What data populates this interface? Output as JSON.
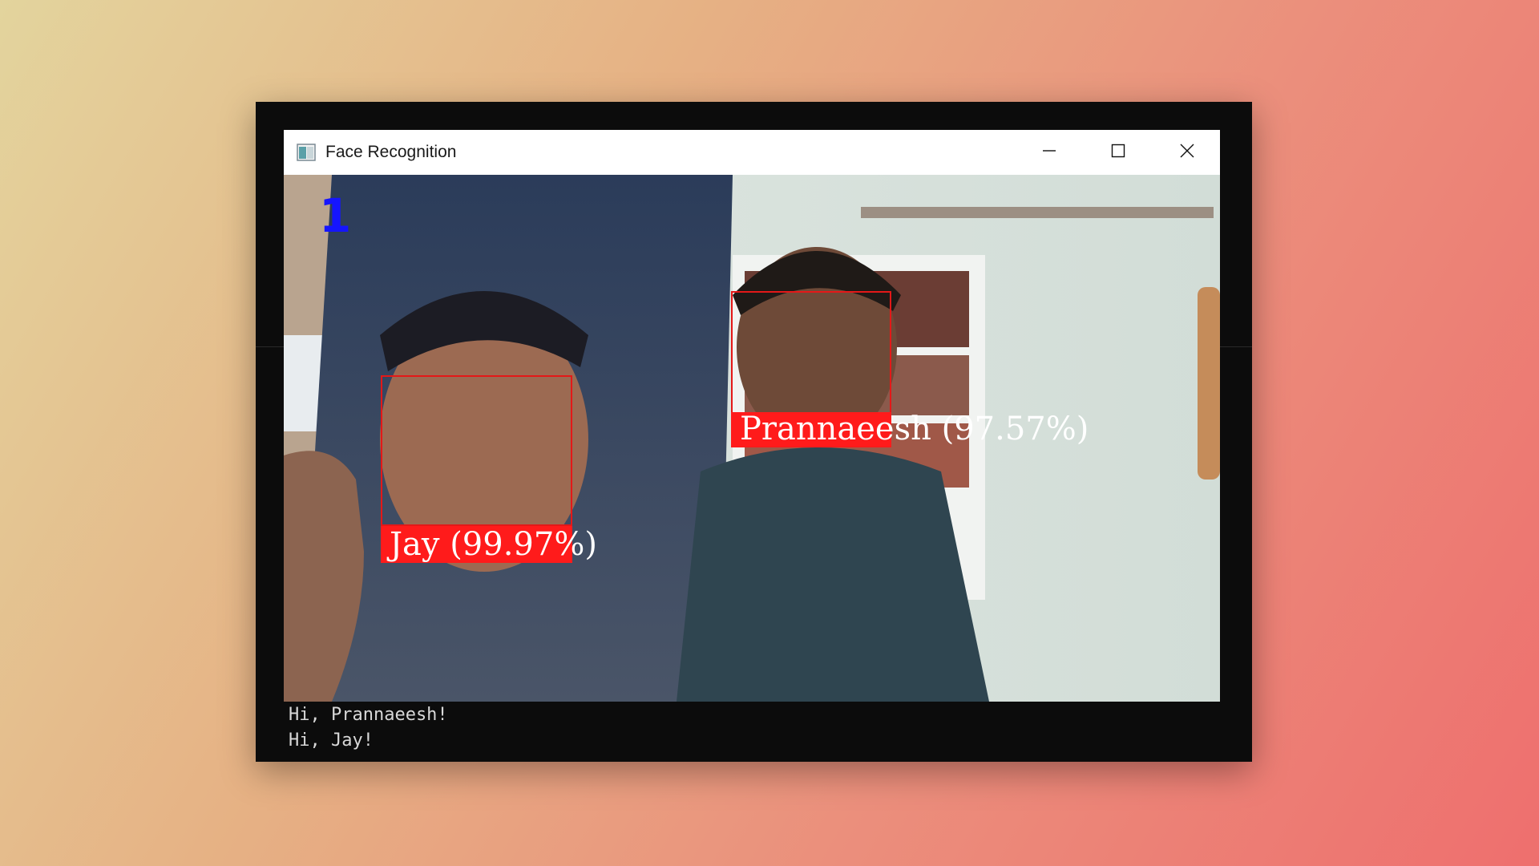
{
  "window": {
    "title": "Face Recognition",
    "icon": "app-window-icon",
    "controls": [
      "minimize-icon",
      "maximize-icon",
      "close-icon"
    ]
  },
  "video": {
    "fps_counter": "1",
    "detections": [
      {
        "name_label": "Jay (99.97%)",
        "box_color": "#e41818"
      },
      {
        "name_label": "Prannaeesh (97.57%)",
        "box_color": "#e41818"
      }
    ]
  },
  "console": {
    "lines": [
      "Hi, Prannaeesh!",
      "Hi, Jay!"
    ]
  },
  "colors": {
    "background_start": "#e3d49d",
    "background_end": "#ee6f6e",
    "console_bg": "#0c0c0c",
    "label_bg": "#ff1b1b",
    "fps_color": "#1515ff"
  }
}
